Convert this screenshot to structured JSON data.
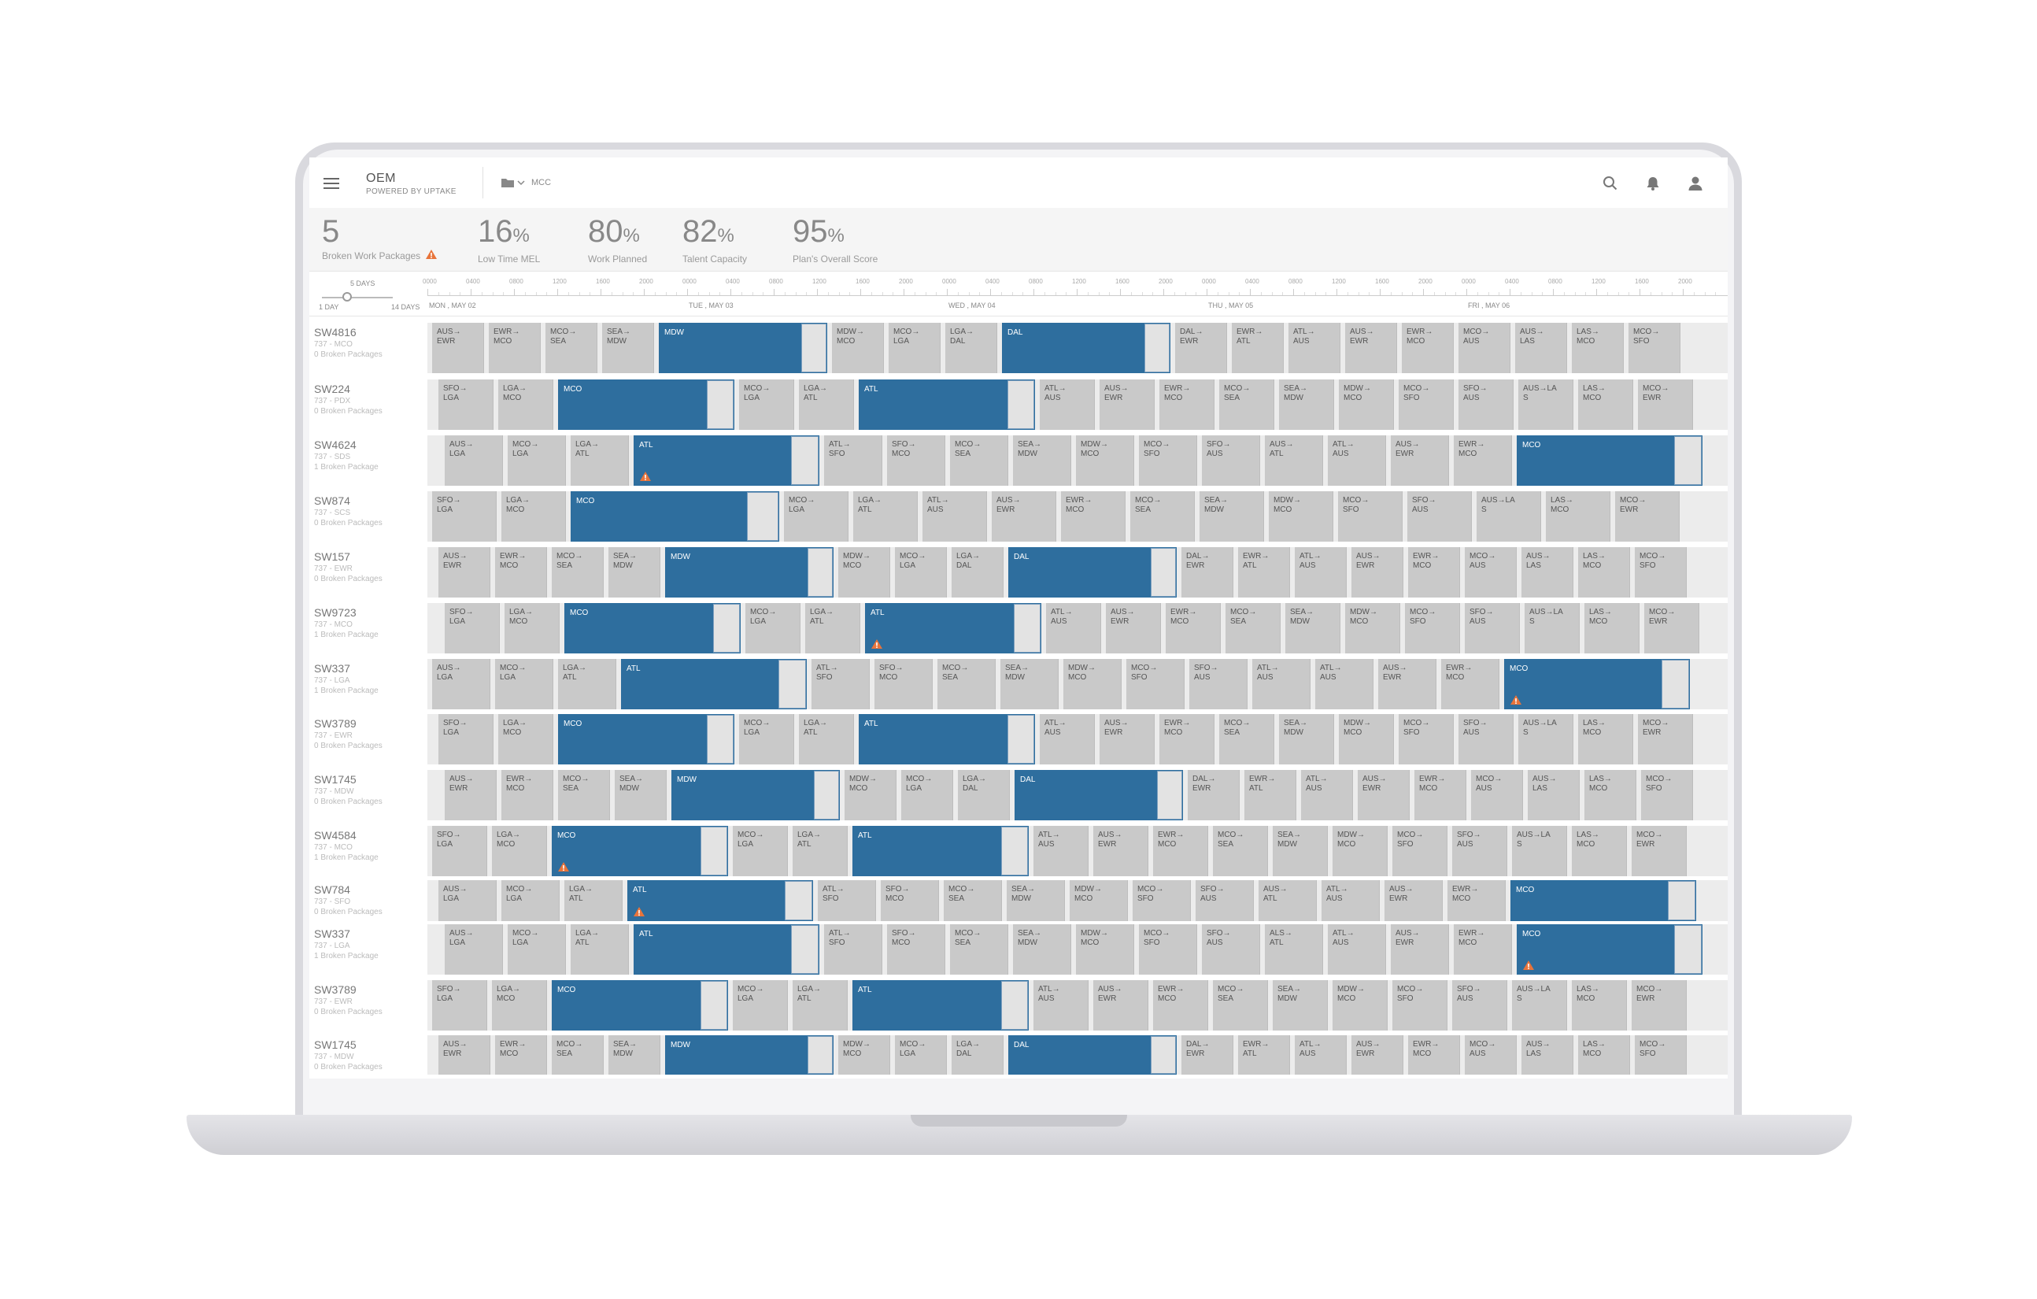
{
  "app": {
    "title": "OEM",
    "subtitle": "POWERED BY UPTAKE",
    "folder_label": "MCC"
  },
  "colors": {
    "primary": "#2e6e9e",
    "leg_grey": "#c9c9c9",
    "lane_bg": "#ececec",
    "warning": "#e8743b"
  },
  "icons": {
    "menu": "hamburger-icon",
    "folder": "folder-icon",
    "search": "search-icon",
    "notifications": "bell-icon",
    "user": "user-icon",
    "warning": "warning-icon"
  },
  "stats": [
    {
      "value": "5",
      "unit": "",
      "label": "Broken Work Packages",
      "warning": true
    },
    {
      "value": "16",
      "unit": "%",
      "label": "Low Time MEL",
      "warning": false
    },
    {
      "value": "80",
      "unit": "%",
      "label": "Work Planned",
      "warning": false
    },
    {
      "value": "82",
      "unit": "%",
      "label": "Talent Capacity",
      "warning": false
    },
    {
      "value": "95",
      "unit": "%",
      "label": "Plan's Overall Score",
      "warning": false
    }
  ],
  "zoom": {
    "current": "5 DAYS",
    "min": "1 DAY",
    "max": "14 DAYS",
    "level": 0.36
  },
  "timeline": {
    "days": [
      "MON , MAY 02",
      "TUE , MAY 03",
      "WED , MAY 04",
      "THU , MAY 05",
      "FRI , MAY 06"
    ],
    "hours": [
      "0000",
      "0400",
      "0800",
      "1200",
      "1600",
      "2000"
    ]
  },
  "aircraft": [
    {
      "id": "SW4816",
      "sub": "737 - MCO",
      "packages": "0 Broken Packages"
    },
    {
      "id": "SW224",
      "sub": "737 - PDX",
      "packages": "0 Broken Packages"
    },
    {
      "id": "SW4624",
      "sub": "737 - SDS",
      "packages": "1 Broken Package"
    },
    {
      "id": "SW874",
      "sub": "737 - SCS",
      "packages": "0 Broken Packages"
    },
    {
      "id": "SW157",
      "sub": "737 - EWR",
      "packages": "0 Broken Packages"
    },
    {
      "id": "SW9723",
      "sub": "737 - MCO",
      "packages": "1 Broken Package"
    },
    {
      "id": "SW337",
      "sub": "737 - LGA",
      "packages": "1 Broken Package"
    },
    {
      "id": "SW3789",
      "sub": "737 - EWR",
      "packages": "0 Broken Packages"
    },
    {
      "id": "SW1745",
      "sub": "737 - MDW",
      "packages": "0 Broken Packages"
    },
    {
      "id": "SW4584",
      "sub": "737 - MCO",
      "packages": "1 Broken Package"
    },
    {
      "id": "SW784",
      "sub": "737 - SFO",
      "packages": "0 Broken Packages"
    },
    {
      "id": "SW337",
      "sub": "737 - LGA",
      "packages": "1 Broken Package"
    },
    {
      "id": "SW3789",
      "sub": "737 - EWR",
      "packages": "0 Broken Packages"
    },
    {
      "id": "SW1745",
      "sub": "737 - MDW",
      "packages": "0 Broken Packages"
    }
  ],
  "schedule": [
    [
      [
        "AUS→",
        "EWR"
      ],
      [
        "EWR→",
        "MCO"
      ],
      [
        "MCO→",
        "SEA"
      ],
      [
        "SEA→",
        "MDW"
      ],
      [
        "MDW",
        "",
        1
      ],
      [
        "MDW→",
        "MCO"
      ],
      [
        "MCO→",
        "LGA"
      ],
      [
        "LGA→",
        "DAL"
      ],
      [
        "DAL",
        "",
        1
      ],
      [
        "DAL→",
        "EWR"
      ],
      [
        "EWR→",
        "ATL"
      ],
      [
        "ATL→",
        "AUS"
      ],
      [
        "AUS→",
        "EWR"
      ],
      [
        "EWR→",
        "MCO"
      ],
      [
        "MCO→",
        "AUS"
      ],
      [
        "AUS→",
        "LAS"
      ],
      [
        "LAS→",
        "MCO"
      ],
      [
        "MCO→",
        "SFO"
      ]
    ],
    [
      [
        "SFO→",
        "LGA"
      ],
      [
        "LGA→",
        "MCO"
      ],
      [
        "MCO",
        "",
        1
      ],
      [
        "MCO→",
        "LGA"
      ],
      [
        "LGA→",
        "ATL"
      ],
      [
        "ATL",
        "",
        1
      ],
      [
        "ATL→",
        "AUS"
      ],
      [
        "AUS→",
        "EWR"
      ],
      [
        "EWR→",
        "MCO"
      ],
      [
        "MCO→",
        "SEA"
      ],
      [
        "SEA→",
        "MDW"
      ],
      [
        "MDW→",
        "MCO"
      ],
      [
        "MCO→",
        "SFO"
      ],
      [
        "SFO→",
        "AUS"
      ],
      [
        "AUS→LA",
        "S"
      ],
      [
        "LAS→",
        "MCO"
      ],
      [
        "MCO→",
        "EWR"
      ]
    ],
    [
      [
        "AUS→",
        "LGA"
      ],
      [
        "MCO→",
        "LGA"
      ],
      [
        "LGA→",
        "ATL"
      ],
      [
        "ATL",
        "",
        1,
        1
      ],
      [
        "ATL→",
        "SFO"
      ],
      [
        "SFO→",
        "MCO"
      ],
      [
        "MCO→",
        "SEA"
      ],
      [
        "SEA→",
        "MDW"
      ],
      [
        "MDW→",
        "MCO"
      ],
      [
        "MCO→",
        "SFO"
      ],
      [
        "SFO→",
        "AUS"
      ],
      [
        "AUS→",
        "ATL"
      ],
      [
        "ATL→",
        "AUS"
      ],
      [
        "AUS→",
        "EWR"
      ],
      [
        "EWR→",
        "MCO"
      ],
      [
        "MCO",
        "",
        1
      ]
    ],
    [
      [
        "SFO→",
        "LGA"
      ],
      [
        "LGA→",
        "MCO"
      ],
      [
        "MCO",
        "",
        1
      ],
      [
        "MCO→",
        "LGA"
      ],
      [
        "LGA→",
        "ATL"
      ],
      [
        "ATL→",
        "AUS"
      ],
      [
        "AUS→",
        "EWR"
      ],
      [
        "EWR→",
        "MCO"
      ],
      [
        "MCO→",
        "SEA"
      ],
      [
        "SEA→",
        "MDW"
      ],
      [
        "MDW→",
        "MCO"
      ],
      [
        "MCO→",
        "SFO"
      ],
      [
        "SFO→",
        "AUS"
      ],
      [
        "AUS→LA",
        "S"
      ],
      [
        "LAS→",
        "MCO"
      ],
      [
        "MCO→",
        "EWR"
      ]
    ],
    [
      [
        "AUS→",
        "EWR"
      ],
      [
        "EWR→",
        "MCO"
      ],
      [
        "MCO→",
        "SEA"
      ],
      [
        "SEA→",
        "MDW"
      ],
      [
        "MDW",
        "",
        1
      ],
      [
        "MDW→",
        "MCO"
      ],
      [
        "MCO→",
        "LGA"
      ],
      [
        "LGA→",
        "DAL"
      ],
      [
        "DAL",
        "",
        1
      ],
      [
        "DAL→",
        "EWR"
      ],
      [
        "EWR→",
        "ATL"
      ],
      [
        "ATL→",
        "AUS"
      ],
      [
        "AUS→",
        "EWR"
      ],
      [
        "EWR→",
        "MCO"
      ],
      [
        "MCO→",
        "AUS"
      ],
      [
        "AUS→",
        "LAS"
      ],
      [
        "LAS→",
        "MCO"
      ],
      [
        "MCO→",
        "SFO"
      ]
    ],
    [
      [
        "SFO→",
        "LGA"
      ],
      [
        "LGA→",
        "MCO"
      ],
      [
        "MCO",
        "",
        1
      ],
      [
        "MCO→",
        "LGA"
      ],
      [
        "LGA→",
        "ATL"
      ],
      [
        "ATL",
        "",
        1,
        1
      ],
      [
        "ATL→",
        "AUS"
      ],
      [
        "AUS→",
        "EWR"
      ],
      [
        "EWR→",
        "MCO"
      ],
      [
        "MCO→",
        "SEA"
      ],
      [
        "SEA→",
        "MDW"
      ],
      [
        "MDW→",
        "MCO"
      ],
      [
        "MCO→",
        "SFO"
      ],
      [
        "SFO→",
        "AUS"
      ],
      [
        "AUS→LA",
        "S"
      ],
      [
        "LAS→",
        "MCO"
      ],
      [
        "MCO→",
        "EWR"
      ]
    ],
    [
      [
        "AUS→",
        "LGA"
      ],
      [
        "MCO→",
        "LGA"
      ],
      [
        "LGA→",
        "ATL"
      ],
      [
        "ATL",
        "",
        1
      ],
      [
        "ATL→",
        "SFO"
      ],
      [
        "SFO→",
        "MCO"
      ],
      [
        "MCO→",
        "SEA"
      ],
      [
        "SEA→",
        "MDW"
      ],
      [
        "MDW→",
        "MCO"
      ],
      [
        "MCO→",
        "SFO"
      ],
      [
        "SFO→",
        "AUS"
      ],
      [
        "ATL→",
        "AUS"
      ],
      [
        "ATL→",
        "AUS"
      ],
      [
        "AUS→",
        "EWR"
      ],
      [
        "EWR→",
        "MCO"
      ],
      [
        "MCO",
        "",
        1,
        1
      ]
    ],
    [
      [
        "SFO→",
        "LGA"
      ],
      [
        "LGA→",
        "MCO"
      ],
      [
        "MCO",
        "",
        1
      ],
      [
        "MCO→",
        "LGA"
      ],
      [
        "LGA→",
        "ATL"
      ],
      [
        "ATL",
        "",
        1
      ],
      [
        "ATL→",
        "AUS"
      ],
      [
        "AUS→",
        "EWR"
      ],
      [
        "EWR→",
        "MCO"
      ],
      [
        "MCO→",
        "SEA"
      ],
      [
        "SEA→",
        "MDW"
      ],
      [
        "MDW→",
        "MCO"
      ],
      [
        "MCO→",
        "SFO"
      ],
      [
        "SFO→",
        "AUS"
      ],
      [
        "AUS→LA",
        "S"
      ],
      [
        "LAS→",
        "MCO"
      ],
      [
        "MCO→",
        "EWR"
      ]
    ],
    [
      [
        "AUS→",
        "EWR"
      ],
      [
        "EWR→",
        "MCO"
      ],
      [
        "MCO→",
        "SEA"
      ],
      [
        "SEA→",
        "MDW"
      ],
      [
        "MDW",
        "",
        1
      ],
      [
        "MDW→",
        "MCO"
      ],
      [
        "MCO→",
        "LGA"
      ],
      [
        "LGA→",
        "DAL"
      ],
      [
        "DAL",
        "",
        1
      ],
      [
        "DAL→",
        "EWR"
      ],
      [
        "EWR→",
        "ATL"
      ],
      [
        "ATL→",
        "AUS"
      ],
      [
        "AUS→",
        "EWR"
      ],
      [
        "EWR→",
        "MCO"
      ],
      [
        "MCO→",
        "AUS"
      ],
      [
        "AUS→",
        "LAS"
      ],
      [
        "LAS→",
        "MCO"
      ],
      [
        "MCO→",
        "SFO"
      ]
    ],
    [
      [
        "SFO→",
        "LGA"
      ],
      [
        "LGA→",
        "MCO"
      ],
      [
        "MCO",
        "",
        1,
        1
      ],
      [
        "MCO→",
        "LGA"
      ],
      [
        "LGA→",
        "ATL"
      ],
      [
        "ATL",
        "",
        1
      ],
      [
        "ATL→",
        "AUS"
      ],
      [
        "AUS→",
        "EWR"
      ],
      [
        "EWR→",
        "MCO"
      ],
      [
        "MCO→",
        "SEA"
      ],
      [
        "SEA→",
        "MDW"
      ],
      [
        "MDW→",
        "MCO"
      ],
      [
        "MCO→",
        "SFO"
      ],
      [
        "SFO→",
        "AUS"
      ],
      [
        "AUS→LA",
        "S"
      ],
      [
        "LAS→",
        "MCO"
      ],
      [
        "MCO→",
        "EWR"
      ]
    ],
    [
      [
        "AUS→",
        "LGA"
      ],
      [
        "MCO→",
        "LGA"
      ],
      [
        "LGA→",
        "ATL"
      ],
      [
        "ATL",
        "",
        1,
        1
      ],
      [
        "ATL→",
        "SFO"
      ],
      [
        "SFO→",
        "MCO"
      ],
      [
        "MCO→",
        "SEA"
      ],
      [
        "SEA→",
        "MDW"
      ],
      [
        "MDW→",
        "MCO"
      ],
      [
        "MCO→",
        "SFO"
      ],
      [
        "SFO→",
        "AUS"
      ],
      [
        "AUS→",
        "ATL"
      ],
      [
        "ATL→",
        "AUS"
      ],
      [
        "AUS→",
        "EWR"
      ],
      [
        "EWR→",
        "MCO"
      ],
      [
        "MCO",
        "",
        1
      ]
    ],
    [
      [
        "AUS→",
        "LGA"
      ],
      [
        "MCO→",
        "LGA"
      ],
      [
        "LGA→",
        "ATL"
      ],
      [
        "ATL",
        "",
        1
      ],
      [
        "ATL→",
        "SFO"
      ],
      [
        "SFO→",
        "MCO"
      ],
      [
        "MCO→",
        "SEA"
      ],
      [
        "SEA→",
        "MDW"
      ],
      [
        "MDW→",
        "MCO"
      ],
      [
        "MCO→",
        "SFO"
      ],
      [
        "SFO→",
        "AUS"
      ],
      [
        "ALS→",
        "ATL"
      ],
      [
        "ATL→",
        "AUS"
      ],
      [
        "AUS→",
        "EWR"
      ],
      [
        "EWR→",
        "MCO"
      ],
      [
        "MCO",
        "",
        1,
        1
      ]
    ],
    [
      [
        "SFO→",
        "LGA"
      ],
      [
        "LGA→",
        "MCO"
      ],
      [
        "MCO",
        "",
        1
      ],
      [
        "MCO→",
        "LGA"
      ],
      [
        "LGA→",
        "ATL"
      ],
      [
        "ATL",
        "",
        1
      ],
      [
        "ATL→",
        "AUS"
      ],
      [
        "AUS→",
        "EWR"
      ],
      [
        "EWR→",
        "MCO"
      ],
      [
        "MCO→",
        "SEA"
      ],
      [
        "SEA→",
        "MDW"
      ],
      [
        "MDW→",
        "MCO"
      ],
      [
        "MCO→",
        "SFO"
      ],
      [
        "SFO→",
        "AUS"
      ],
      [
        "AUS→LA",
        "S"
      ],
      [
        "LAS→",
        "MCO"
      ],
      [
        "MCO→",
        "EWR"
      ]
    ],
    [
      [
        "AUS→",
        "EWR"
      ],
      [
        "EWR→",
        "MCO"
      ],
      [
        "MCO→",
        "SEA"
      ],
      [
        "SEA→",
        "MDW"
      ],
      [
        "MDW",
        "",
        1
      ],
      [
        "MDW→",
        "MCO"
      ],
      [
        "MCO→",
        "LGA"
      ],
      [
        "LGA→",
        "DAL"
      ],
      [
        "DAL",
        "",
        1
      ],
      [
        "DAL→",
        "EWR"
      ],
      [
        "EWR→",
        "ATL"
      ],
      [
        "ATL→",
        "AUS"
      ],
      [
        "AUS→",
        "EWR"
      ],
      [
        "EWR→",
        "MCO"
      ],
      [
        "MCO→",
        "AUS"
      ],
      [
        "AUS→",
        "LAS"
      ],
      [
        "LAS→",
        "MCO"
      ],
      [
        "MCO→",
        "SFO"
      ]
    ]
  ]
}
